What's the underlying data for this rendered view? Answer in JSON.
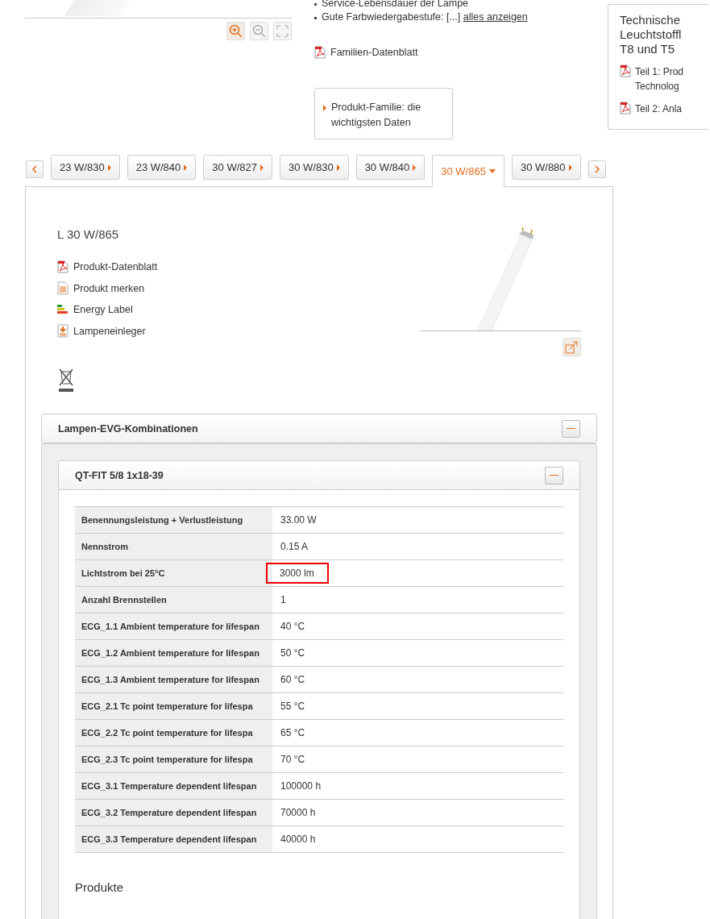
{
  "gallery": {
    "zoom_controls": [
      {
        "kind": "zoom-in",
        "disabled": false
      },
      {
        "kind": "zoom-out",
        "disabled": true
      },
      {
        "kind": "fullscreen",
        "disabled": true
      }
    ]
  },
  "features": [
    {
      "text": "Service-Lebensdauer der Lampe"
    },
    {
      "text": "Gute Farbwiedergabestufe: [...]",
      "link": "alles anzeigen"
    }
  ],
  "family_datasheet": "Familien-Datenblatt",
  "family_box": "Produkt-Familie: die wichtigsten Daten",
  "sidebar": {
    "title_lines": [
      "Technische",
      "Leuchtstoffl",
      "T8 und T5"
    ],
    "links": [
      {
        "lines": [
          "Teil 1: Prod",
          "Technolog"
        ]
      },
      {
        "lines": [
          "Teil 2: Anla"
        ]
      }
    ]
  },
  "variant_tabs": [
    {
      "label": "23 W/830",
      "selected": false
    },
    {
      "label": "23 W/840",
      "selected": false
    },
    {
      "label": "30 W/827",
      "selected": false
    },
    {
      "label": "30 W/830",
      "selected": false
    },
    {
      "label": "30 W/840",
      "selected": false
    },
    {
      "label": "30 W/865",
      "selected": true
    },
    {
      "label": "30 W/880",
      "selected": false
    }
  ],
  "product": {
    "title": "L 30 W/865",
    "links": [
      {
        "kind": "pdf",
        "label": "Produkt-Datenblatt"
      },
      {
        "kind": "note",
        "label": "Produkt merken"
      },
      {
        "kind": "energy",
        "label": "Energy Label"
      },
      {
        "kind": "download",
        "label": "Lampeneinleger"
      }
    ]
  },
  "combinations": {
    "title": "Lampen-EVG-Kombinationen",
    "expanded": true,
    "ballasts": [
      {
        "title": "QT-FIT 5/8 1x18-39",
        "expanded": true,
        "rows": [
          {
            "label": "Benennungsleistung + Verlustleistung",
            "value": "33.00 W",
            "highlighted": false
          },
          {
            "label": "Nennstrom",
            "value": "0.15 A",
            "highlighted": false
          },
          {
            "label": "Lichtstrom bei 25°C",
            "value": "3000 lm",
            "highlighted": true
          },
          {
            "label": "Anzahl Brennstellen",
            "value": "1",
            "highlighted": false
          },
          {
            "label": "ECG_1.1 Ambient temperature for lifespan",
            "value": "40 °C",
            "highlighted": false
          },
          {
            "label": "ECG_1.2 Ambient temperature for lifespan",
            "value": "50 °C",
            "highlighted": false
          },
          {
            "label": "ECG_1.3 Ambient temperature for lifespan",
            "value": "60 °C",
            "highlighted": false
          },
          {
            "label": "ECG_2.1 Tc point temperature for lifespa",
            "value": "55 °C",
            "highlighted": false
          },
          {
            "label": "ECG_2.2 Tc point temperature for lifespa",
            "value": "65 °C",
            "highlighted": false
          },
          {
            "label": "ECG_2.3 Tc point temperature for lifespa",
            "value": "70 °C",
            "highlighted": false
          },
          {
            "label": "ECG_3.1 Temperature dependent lifespan",
            "value": "100000 h",
            "highlighted": false
          },
          {
            "label": "ECG_3.2 Temperature dependent lifespan",
            "value": "70000 h",
            "highlighted": false
          },
          {
            "label": "ECG_3.3 Temperature dependent lifespan",
            "value": "40000 h",
            "highlighted": false
          }
        ]
      }
    ],
    "next_section": "Produkte"
  }
}
